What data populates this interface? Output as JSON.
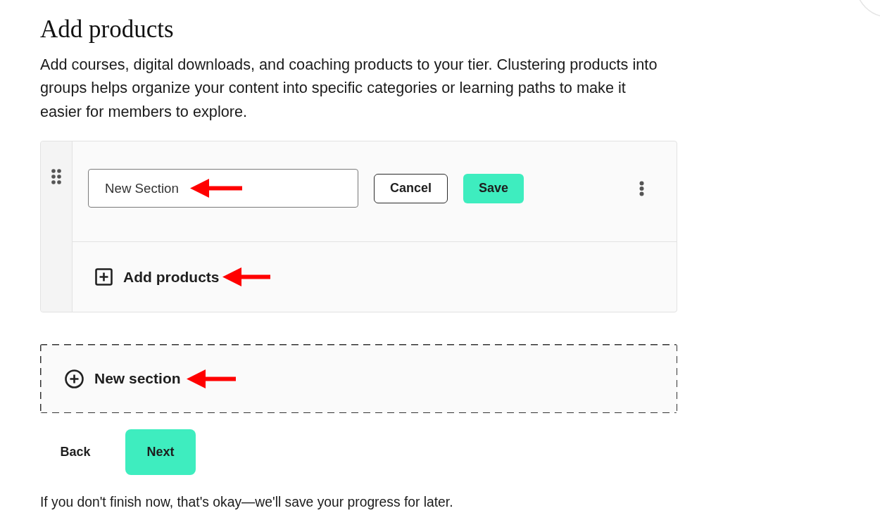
{
  "header": {
    "title": "Add products",
    "description": "Add courses, digital downloads, and coaching products to your tier. Clustering products into groups helps organize your content into specific categories or learning paths to make it easier for members to explore."
  },
  "sections": [
    {
      "name_field": {
        "value": "New Section",
        "annotated": true
      },
      "buttons": [
        {
          "label": "Cancel",
          "kind": "secondary"
        },
        {
          "label": "Save",
          "kind": "primary"
        }
      ],
      "add_products": {
        "label": "Add products",
        "annotated": true
      }
    }
  ],
  "new_section": {
    "label": "New section",
    "annotated": true
  },
  "navigation": [
    {
      "label": "Back",
      "kind": "text"
    },
    {
      "label": "Next",
      "kind": "primary"
    }
  ],
  "footer_note": "If you don't finish now, that's okay—we'll save your progress for later."
}
